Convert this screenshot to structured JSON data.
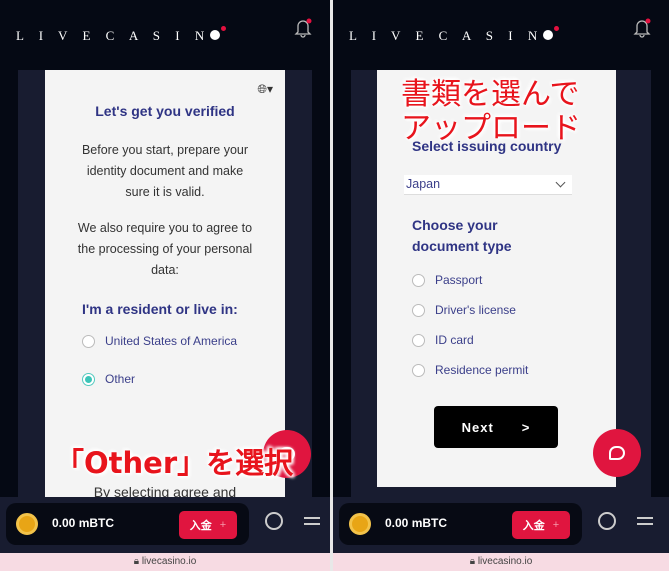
{
  "brand": {
    "logo": "LIVECASINO",
    "accent": "#e0153f",
    "title_color": "#2f3484"
  },
  "left": {
    "title": "Let's get you verified",
    "intro": "Before you start, prepare your identity document and make sure it is valid.",
    "consent": "We also require you to agree to the processing of your personal data:",
    "residence_heading": "I'm a resident or live in:",
    "options": [
      {
        "label": "United States of America",
        "selected": false
      },
      {
        "label": "Other",
        "selected": true
      }
    ],
    "footer_text": "By selecting agree and",
    "annotation": "「Other」を選択"
  },
  "right": {
    "country_heading": "Select issuing country",
    "country_value": "Japan",
    "doc_heading": "Choose your document type",
    "doc_options": [
      {
        "label": "Passport"
      },
      {
        "label": "Driver's license"
      },
      {
        "label": "ID card"
      },
      {
        "label": "Residence permit"
      }
    ],
    "next_label": "Next",
    "next_arrow": ">",
    "annotation_line1": "書類を選んで",
    "annotation_line2": "アップロード"
  },
  "bottom_bar": {
    "balance": "0.00 mBTC",
    "deposit_label": "入金",
    "deposit_plus": "+"
  },
  "url": "livecasino.io",
  "icons": [
    "bell-icon",
    "globe-icon",
    "coin-icon",
    "search-icon",
    "menu-icon",
    "chat-icon",
    "lock-icon"
  ]
}
